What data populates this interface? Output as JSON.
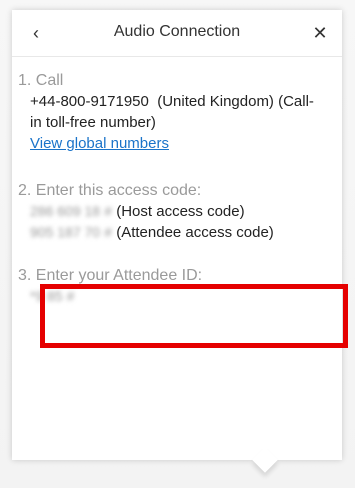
{
  "dialog": {
    "title": "Audio Connection",
    "back_icon": "chevron-left-icon",
    "back_glyph": "‹",
    "close_icon": "close-icon",
    "close_glyph": "✕"
  },
  "step1": {
    "label": "1. Call",
    "number": "+44-800-9171950",
    "description_line1": "(United",
    "description_rest": "Kingdom) (Call-in toll-free number)",
    "link": "View global numbers"
  },
  "step2": {
    "label": "2. Enter this access code:",
    "host_code": "286 609 18",
    "host_hash": "#",
    "host_label": "(Host access code)",
    "attendee_code": "905 187 70",
    "attendee_hash": "#",
    "attendee_label": "(Attendee access code)"
  },
  "step3": {
    "label": "3. Enter your Attendee ID:",
    "value": "*9 85 #"
  },
  "colors": {
    "highlight": "#e50000",
    "link": "#1a73c9",
    "muted": "#9a9a9a"
  }
}
